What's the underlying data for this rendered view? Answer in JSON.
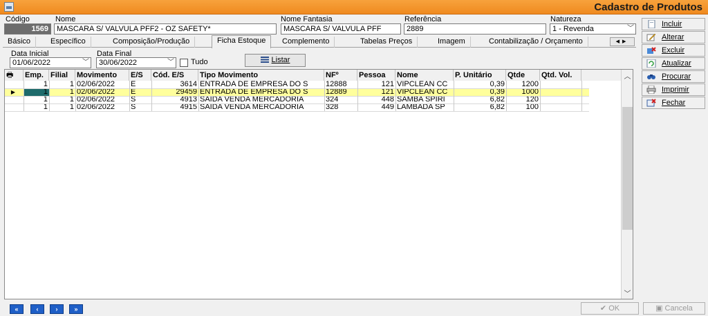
{
  "window": {
    "title": "Cadastro de Produtos",
    "app_icon": "window-icon"
  },
  "header": {
    "codigo_label": "Código",
    "codigo_value": "1569",
    "nome_label": "Nome",
    "nome_value": "MASCARA S/ VALVULA PFF2 - OZ SAFETY*",
    "fantasia_label": "Nome Fantasia",
    "fantasia_value": "MASCARA S/ VALVULA PFF",
    "referencia_label": "Referência",
    "referencia_value": "2889",
    "natureza_label": "Natureza",
    "natureza_value": "1 - Revenda"
  },
  "tabs": [
    {
      "label": "Básico"
    },
    {
      "label": "Específico"
    },
    {
      "label": "Composição/Produção"
    },
    {
      "label": "Ficha Estoque"
    },
    {
      "label": "Complemento"
    },
    {
      "label": "Tabelas Preços"
    },
    {
      "label": "Imagem"
    },
    {
      "label": "Contabilização / Orçamento"
    }
  ],
  "active_tab": "Ficha Estoque",
  "filters": {
    "data_inicial_label": "Data Inicial",
    "data_inicial_value": "01/06/2022",
    "data_final_label": "Data Final",
    "data_final_value": "30/06/2022",
    "tudo_label": "Tudo",
    "tudo_checked": false,
    "listar_label": "Listar"
  },
  "grid": {
    "columns": [
      "Emp.",
      "Filial",
      "Movimento",
      "E/S",
      "Cód. E/S",
      "Tipo Movimento",
      "NFº",
      "Pessoa",
      "Nome",
      "P. Unitário",
      "Qtde",
      "Qtd. Vol."
    ],
    "rows": [
      [
        "1",
        "1",
        "02/06/2022",
        "E",
        "3614",
        "ENTRADA DE EMPRESA DO S",
        "12888",
        "121",
        "VIPCLEAN CC",
        "0,39",
        "1200",
        ""
      ],
      [
        "1",
        "1",
        "02/06/2022",
        "E",
        "29459",
        "ENTRADA DE EMPRESA DO S",
        "12889",
        "121",
        "VIPCLEAN CC",
        "0,39",
        "1000",
        ""
      ],
      [
        "1",
        "1",
        "02/06/2022",
        "S",
        "4913",
        "SAÍDA VENDA MERCADORIA",
        "324",
        "448",
        "SAMBA SPIRI",
        "6,82",
        "120",
        ""
      ],
      [
        "1",
        "1",
        "02/06/2022",
        "S",
        "4915",
        "SAÍDA VENDA MERCADORIA",
        "328",
        "449",
        "LAMBADA SP",
        "6,82",
        "100",
        ""
      ]
    ],
    "selected_row": 1
  },
  "sidebar": [
    {
      "label": "Incluir",
      "icon": "new-document-icon"
    },
    {
      "label": "Alterar",
      "icon": "edit-pencil-icon"
    },
    {
      "label": "Excluir",
      "icon": "delete-icon"
    },
    {
      "label": "Atualizar",
      "icon": "refresh-icon"
    },
    {
      "label": "Procurar",
      "icon": "binoculars-icon"
    },
    {
      "label": "Imprimir",
      "icon": "printer-icon"
    },
    {
      "label": "Fechar",
      "icon": "close-door-icon"
    }
  ],
  "footer": {
    "ok_label": "OK",
    "cancel_label": "Cancela"
  },
  "colors": {
    "titlebar": "#ef8a1f",
    "selected_row": "#ffff9c",
    "nav_button": "#1f5fc7"
  }
}
